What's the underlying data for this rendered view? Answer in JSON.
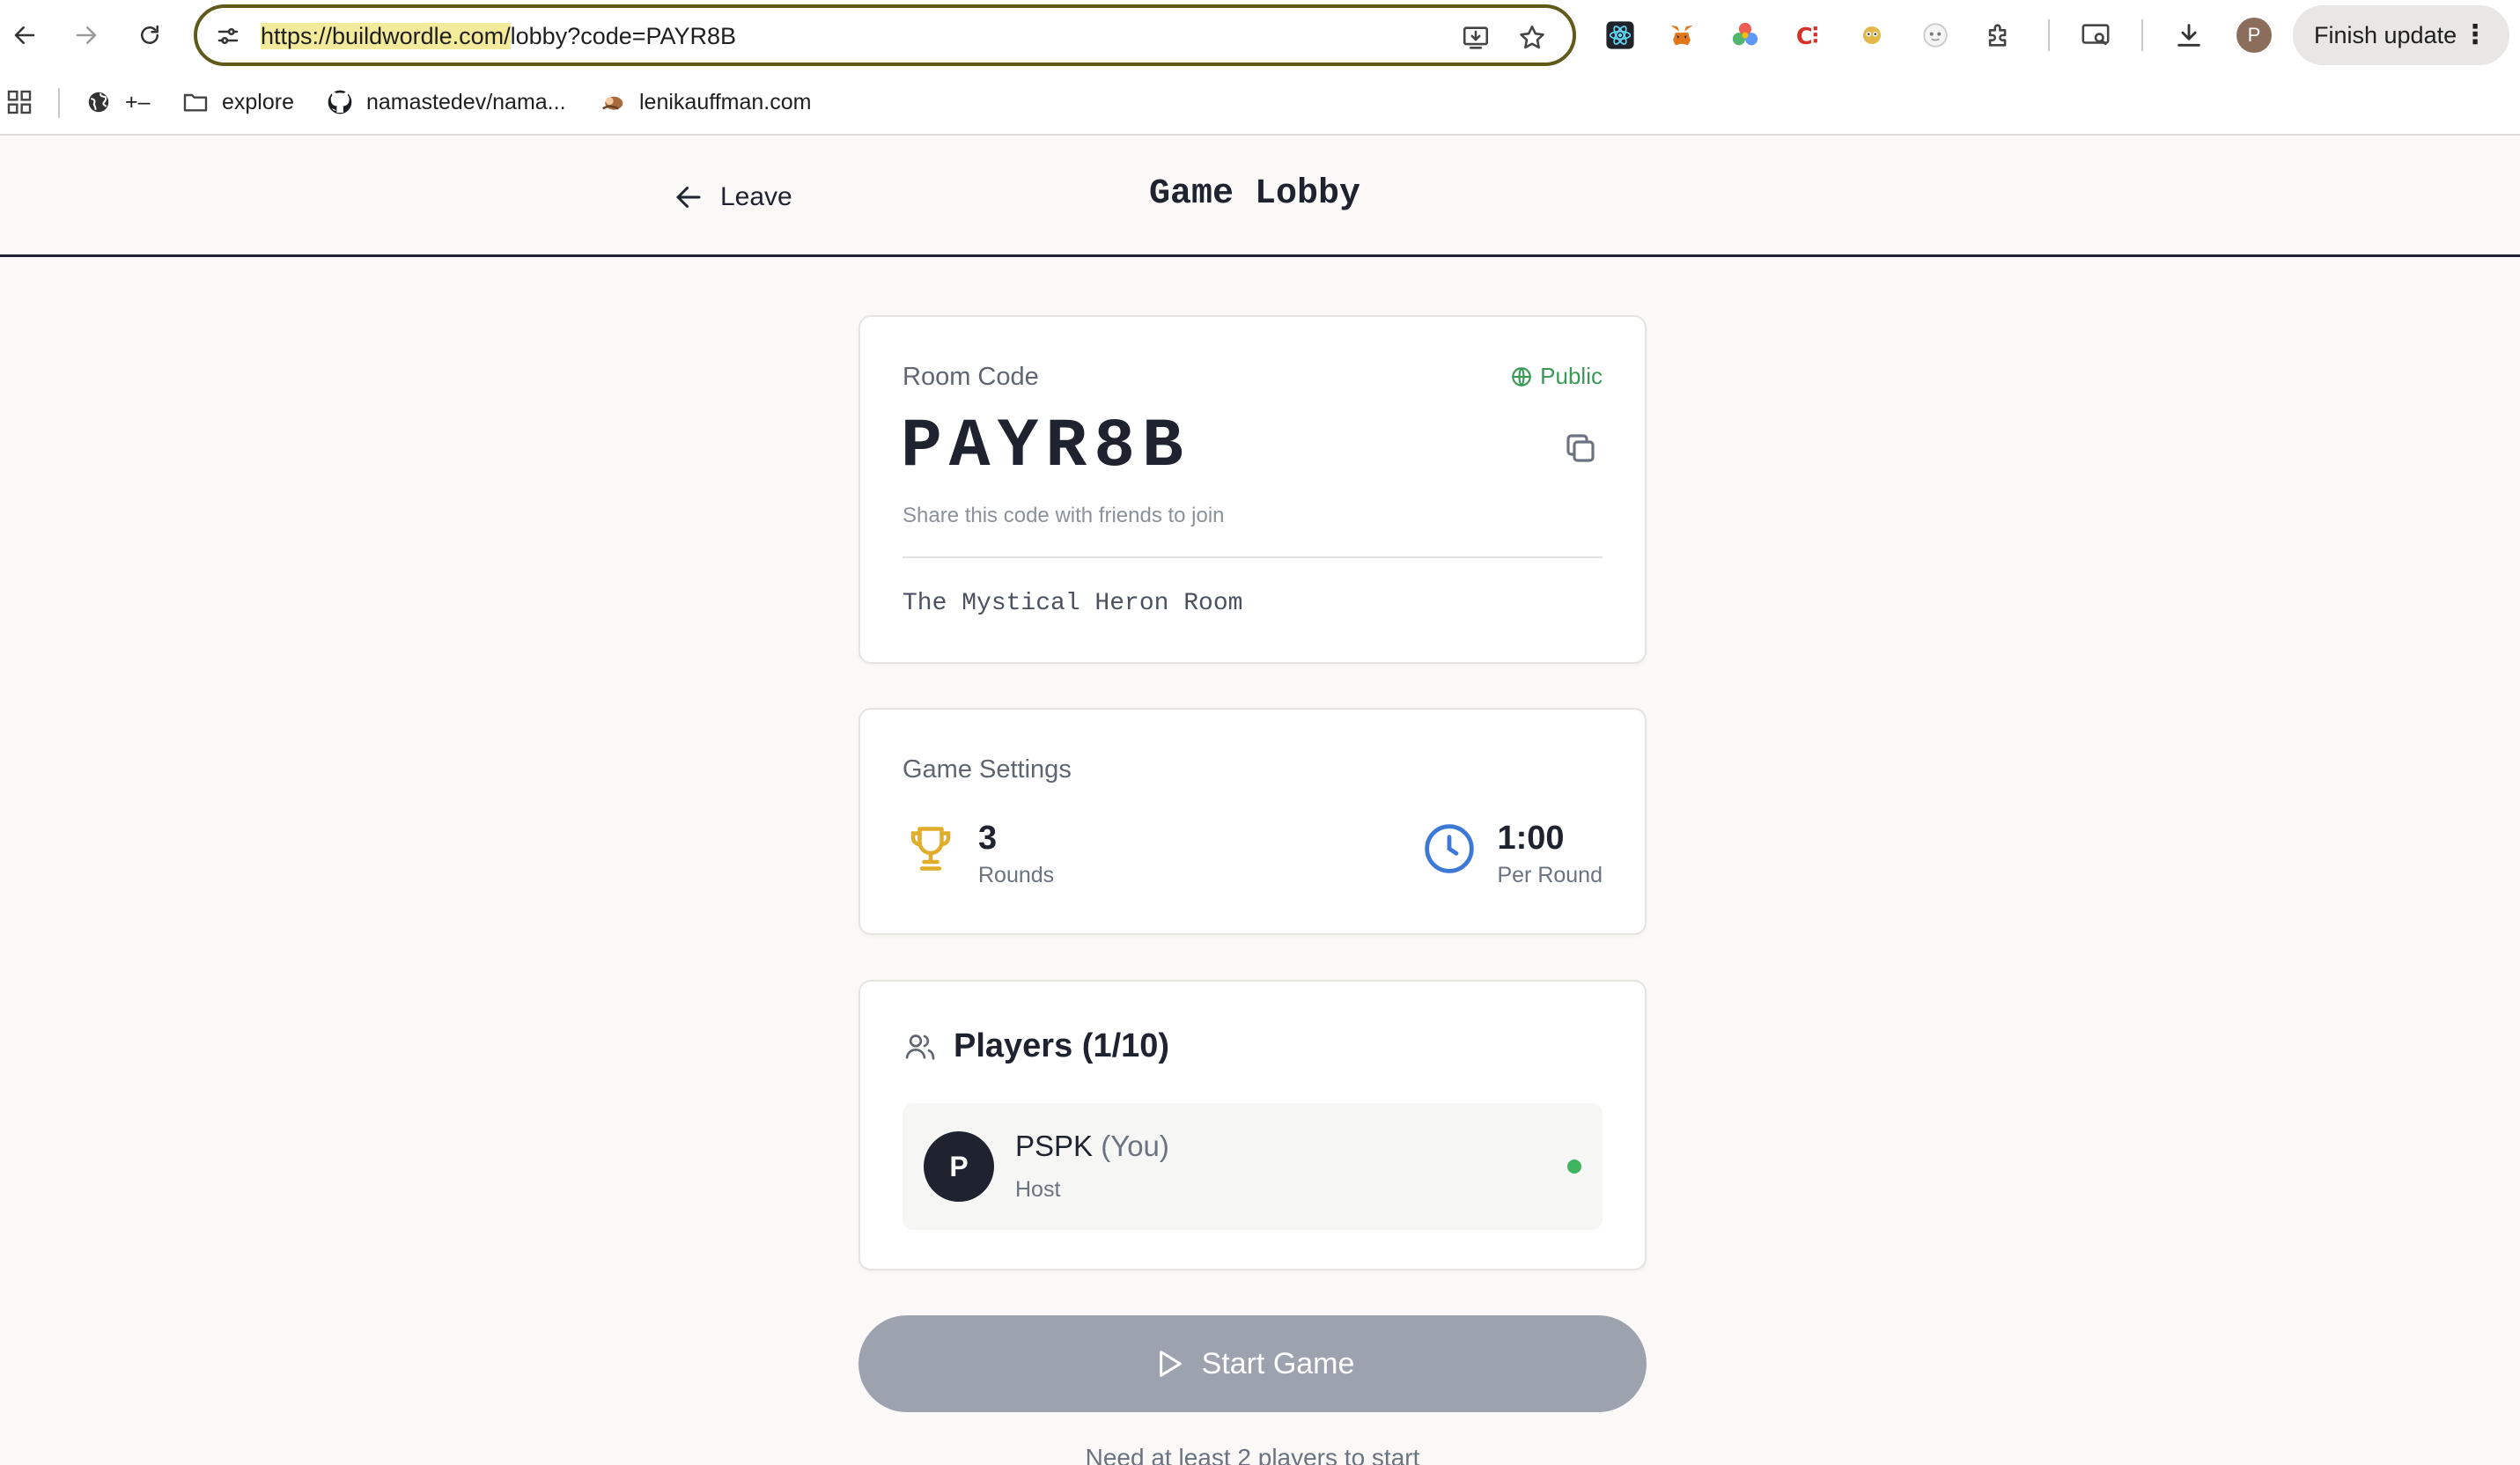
{
  "browser": {
    "url_highlighted": "https://buildwordle.com/",
    "url_rest": "lobby?code=PAYR8B",
    "finish_update_label": "Finish update",
    "profile_initial": "P",
    "bookmarks": [
      {
        "label": "+–",
        "icon": "globe-icon"
      },
      {
        "label": "explore",
        "icon": "folder-icon"
      },
      {
        "label": "namastedev/nama...",
        "icon": "github-icon"
      },
      {
        "label": "lenikauffman.com",
        "icon": "site-favicon"
      }
    ]
  },
  "header": {
    "leave_label": "Leave",
    "title": "Game Lobby"
  },
  "room": {
    "label": "Room Code",
    "visibility": "Public",
    "code": "PAYR8B",
    "share_hint": "Share this code with friends to join",
    "name": "The Mystical Heron Room"
  },
  "settings": {
    "label": "Game Settings",
    "rounds_value": "3",
    "rounds_unit": "Rounds",
    "time_value": "1:00",
    "time_unit": "Per Round"
  },
  "players": {
    "title": "Players (1/10)",
    "list": [
      {
        "initial": "P",
        "name": "PSPK",
        "you_tag": "(You)",
        "role": "Host",
        "online": true
      }
    ]
  },
  "actions": {
    "start_label": "Start Game",
    "start_hint": "Need at least 2 players to start"
  },
  "colors": {
    "accent_dark": "#1f2330",
    "public_green": "#3a9a55",
    "trophy_gold": "#e2ad2b",
    "clock_blue": "#3c78d8",
    "start_disabled": "#9ca3af",
    "online_green": "#3fb45f"
  }
}
